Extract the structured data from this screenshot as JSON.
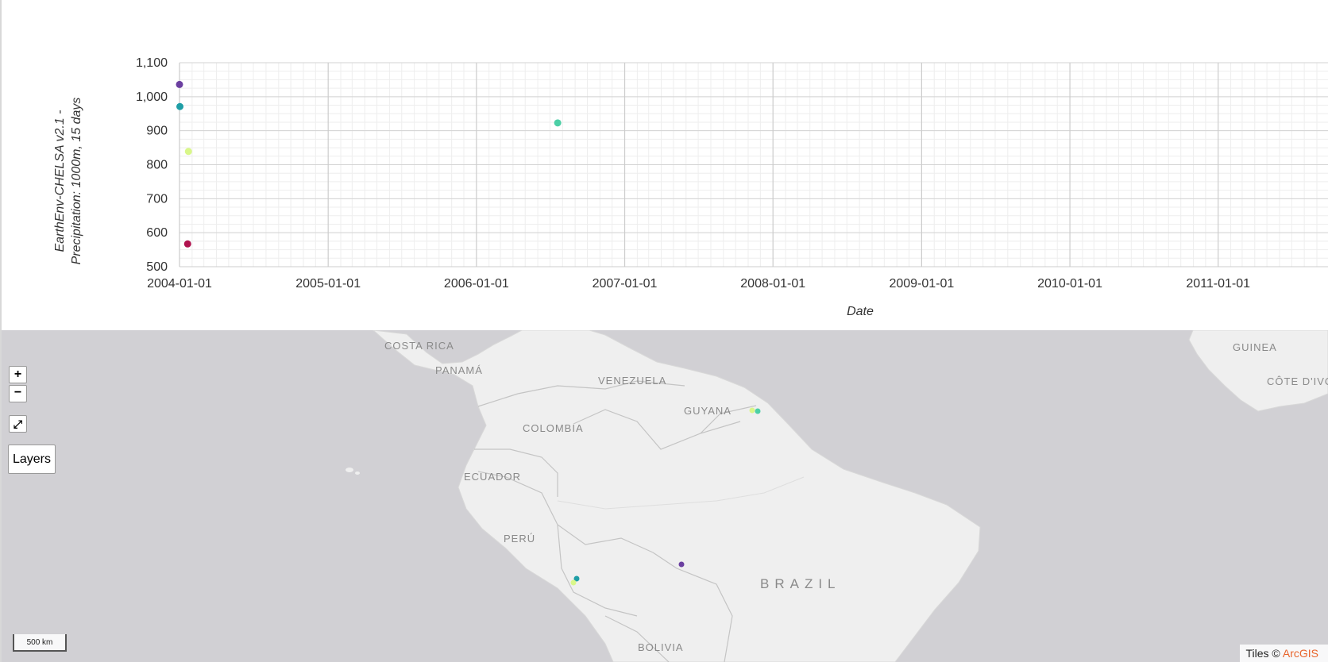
{
  "chart_data": {
    "type": "scatter",
    "title": "",
    "xlabel": "Date",
    "ylabel": "EarthEnv-CHELSA v2.1 - Precipitation: 1000m, 15 days",
    "ylim": [
      500,
      1100
    ],
    "xlim": [
      "2004-01-01",
      "2011-12-31"
    ],
    "y_ticks": [
      "500",
      "600",
      "700",
      "800",
      "900",
      "1,000",
      "1,100"
    ],
    "x_ticks": [
      "2004-01-01",
      "2005-01-01",
      "2006-01-01",
      "2007-01-01",
      "2008-01-01",
      "2009-01-01",
      "2010-01-01",
      "2011-01-01"
    ],
    "grid": true,
    "points": [
      {
        "x": "2004-01-01",
        "y": 1036,
        "color": "#6b3fa0"
      },
      {
        "x": "2004-01-02",
        "y": 971,
        "color": "#1f9ea6"
      },
      {
        "x": "2004-01-23",
        "y": 839,
        "color": "#d9f78a"
      },
      {
        "x": "2004-01-21",
        "y": 567,
        "color": "#b0124e"
      },
      {
        "x": "2006-07-20",
        "y": 923,
        "color": "#4ccfa6"
      }
    ]
  },
  "map": {
    "labels": [
      {
        "text": "COSTA RICA",
        "style": "small"
      },
      {
        "text": "PANAMÁ",
        "style": "small"
      },
      {
        "text": "VENEZUELA",
        "style": "small"
      },
      {
        "text": "GUYANA",
        "style": "small"
      },
      {
        "text": "COLOMBIA",
        "style": "small"
      },
      {
        "text": "ECUADOR",
        "style": "small"
      },
      {
        "text": "PERÚ",
        "style": "small"
      },
      {
        "text": "BRAZIL",
        "style": "big"
      },
      {
        "text": "BOLIVIA",
        "style": "small"
      },
      {
        "text": "GUINEA",
        "style": "small"
      },
      {
        "text": "CÔTE D'IVO",
        "style": "small"
      }
    ],
    "markers": [
      {
        "color": "#d9f78a"
      },
      {
        "color": "#4ccfa6"
      },
      {
        "color": "#6b3fa0"
      },
      {
        "color": "#1f9ea6"
      },
      {
        "color": "#d9f78a"
      }
    ],
    "controls": {
      "zoom_in": "+",
      "zoom_out": "−",
      "fullscreen": "⤢",
      "layers": "Layers"
    },
    "scale": "500 km",
    "attribution_prefix": "Tiles © ",
    "attribution_link": "ArcGIS",
    "colors": {
      "water": "#d1d0d4",
      "land": "#efefef",
      "border": "#c4c4c4"
    }
  }
}
